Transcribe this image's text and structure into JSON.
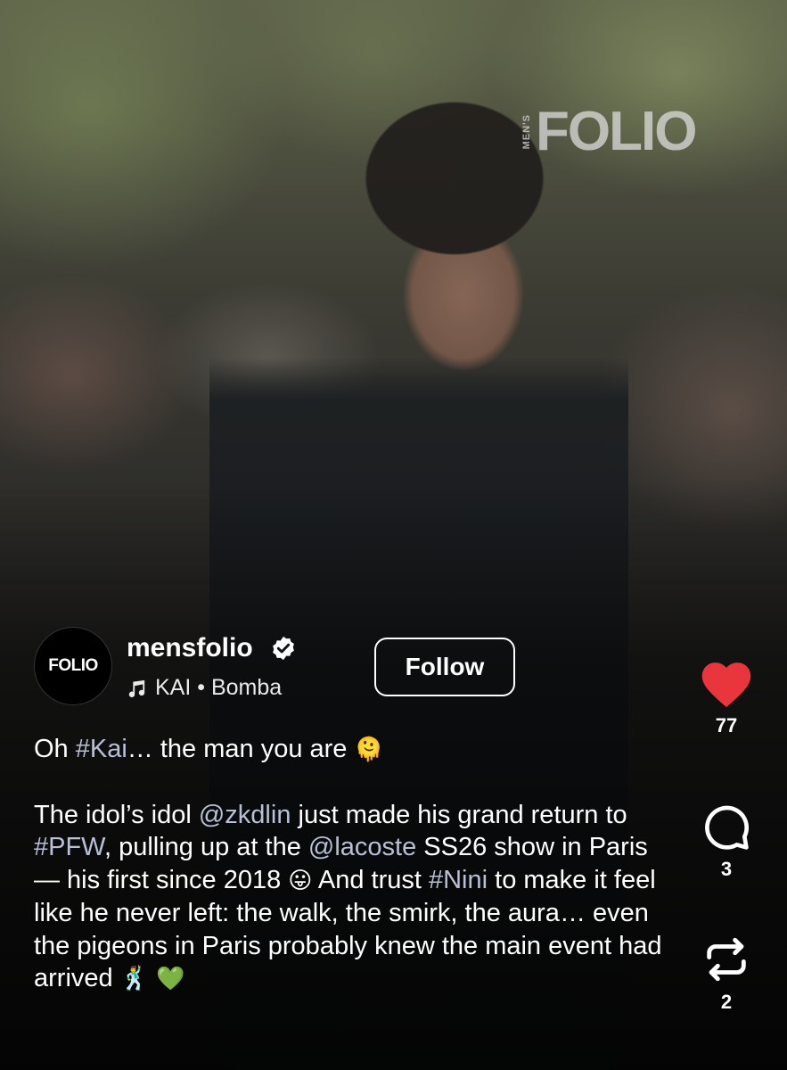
{
  "watermark": {
    "small": "MEN'S",
    "brand": "FOLIO"
  },
  "account": {
    "avatar_text": "FOLIO",
    "username": "mensfolio",
    "verified_icon": "verified-badge-icon",
    "music_icon": "music-note-icon",
    "music_text": "KAI • Bomba",
    "follow_label": "Follow"
  },
  "caption": {
    "line1_pre": "Oh ",
    "line1_tag": "#Kai",
    "line1_post": "… the man you are ",
    "line1_emoji": "🫠",
    "p2_a": "The idol’s idol ",
    "p2_mention1": "@zkdlin",
    "p2_b": " just made his grand return to ",
    "p2_tag1": "#PFW",
    "p2_c": ", pulling up at the ",
    "p2_mention2": "@lacoste",
    "p2_d": " SS26 show in Paris — his first since 2018 ",
    "p2_emoji1": "😛",
    "p2_e": " And trust ",
    "p2_tag2": "#Nini",
    "p2_f": " to make it feel like he never left: the walk, the smirk, the aura… even the pigeons in Paris probably knew the main event had arrived ",
    "p2_emoji2": "🕺",
    "p2_emoji3": "💚"
  },
  "actions": {
    "like_icon": "heart-icon",
    "like_count": "77",
    "like_color": "#e8363c",
    "comment_icon": "comment-bubble-icon",
    "comment_count": "3",
    "repost_icon": "repost-icon",
    "repost_count": "2"
  }
}
